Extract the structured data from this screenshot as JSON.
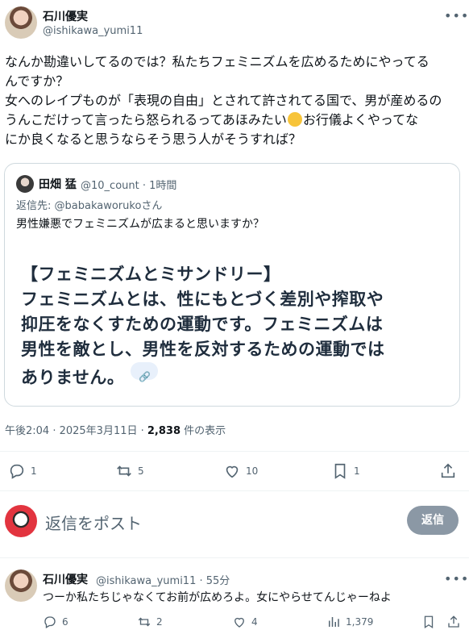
{
  "main_post": {
    "author_name": "石川優実",
    "handle": "@ishikawa_yumi11",
    "more_icon": "more-icon",
    "body_lines": [
      "なんか勘違いしてるのでは？私たちフェミニズムを広めるためにやってる",
      "んですか？",
      "女へのレイプものが「表現の自由」とされて許されてる国で、男が産めるの",
      "うんこだけって言ったら怒られるってあほみたい",
      "お行儀よくやってな",
      "にか良くなると思うならそう思う人がそうすれば？"
    ],
    "timestamp": "午後2:04 · 2025年3月11日 · ",
    "views_count": "2,838",
    "views_label": " 件の表示"
  },
  "quoted_post": {
    "author_name": "田畑 猛",
    "meta": "@10_count · 1時間",
    "reply_to_prefix": "返信先: ",
    "reply_to_handle": "@babakaworukoさん",
    "text": "男性嫌悪でフェミニズムが広まると思いますか？",
    "quote_lines": [
      "【フェミニズムとミサンドリー】",
      "フェミニズムとは、性にもとづく差別や搾取や",
      "抑圧をなくすための運動です。フェミニズムは",
      "男性を敵とし、男性を反対するための運動では",
      "ありません。"
    ],
    "link_icon": "link-icon"
  },
  "actions": {
    "reply_count": "1",
    "repost_count": "5",
    "like_count": "10",
    "bookmark_count": "1"
  },
  "reply_composer": {
    "placeholder": "返信をポスト",
    "button_label": "返信"
  },
  "reply_post": {
    "author_name": "石川優実",
    "meta": "@ishikawa_yumi11 · 55分",
    "text": "つーか私たちじゃなくてお前が広めろよ。女にやらせてんじゃーねよ",
    "reply_count": "6",
    "repost_count": "2",
    "like_count": "4",
    "views_count": "1,379"
  },
  "colors": {
    "text_primary": "#0f1419",
    "text_secondary": "#536471",
    "border": "#cfd9de",
    "reply_button_bg": "#8b98a5"
  }
}
